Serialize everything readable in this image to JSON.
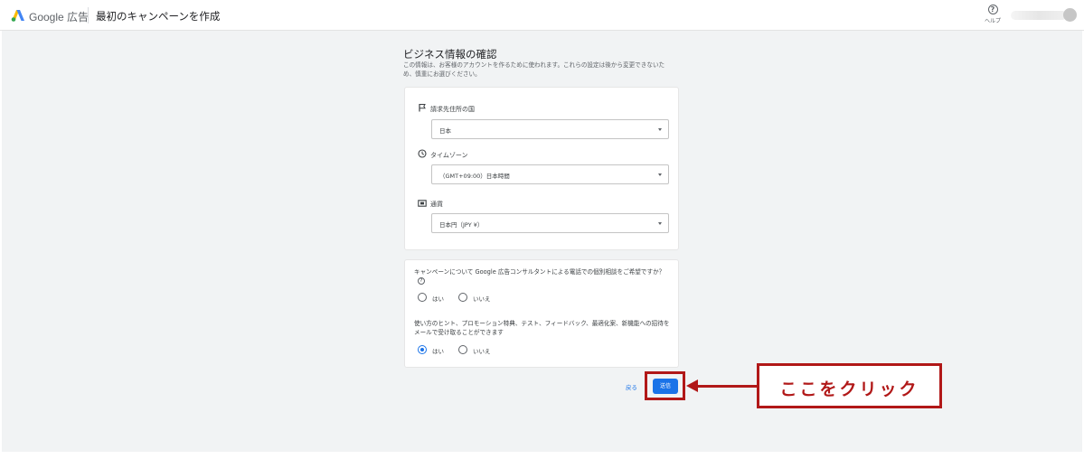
{
  "header": {
    "brand": "Google 広告",
    "title": "最初のキャンペーンを作成",
    "help_label": "ヘルプ",
    "help_glyph": "?",
    "logo_colors": [
      "#fbbc04",
      "#4285f4",
      "#34a853"
    ]
  },
  "page": {
    "title": "ビジネス情報の確認",
    "description": "この情報は、お客様のアカウントを作るために使われます。これらの設定は後から変更できないため、慎重にお選びください。"
  },
  "fields": {
    "country": {
      "label": "請求先住所の国",
      "value": "日本",
      "icon": "flag-icon"
    },
    "timezone": {
      "label": "タイムゾーン",
      "value": "（GMT+09:00）日本時間",
      "icon": "clock-icon"
    },
    "currency": {
      "label": "通貨",
      "value": "日本円（JPY ¥）",
      "icon": "currency-icon"
    }
  },
  "consultation": {
    "question": "キャンペーンについて Google 広告コンサルタントによる電話での個別相談をご希望ですか？",
    "help_glyph": "?",
    "options": [
      "はい",
      "いいえ"
    ],
    "selected": null
  },
  "email_opt_in": {
    "question": "使い方のヒント、プロモーション特典、テスト、フィードバック、最適化案、新機能への招待をメールで受け取ることができます",
    "options": [
      "はい",
      "いいえ"
    ],
    "selected": "はい"
  },
  "actions": {
    "back_label": "戻る",
    "submit_label": "送信"
  },
  "annotation": {
    "callout_text": "ここをクリック",
    "color": "#b11818"
  },
  "colors": {
    "accent": "#1a73e8",
    "background": "#f1f3f4"
  }
}
